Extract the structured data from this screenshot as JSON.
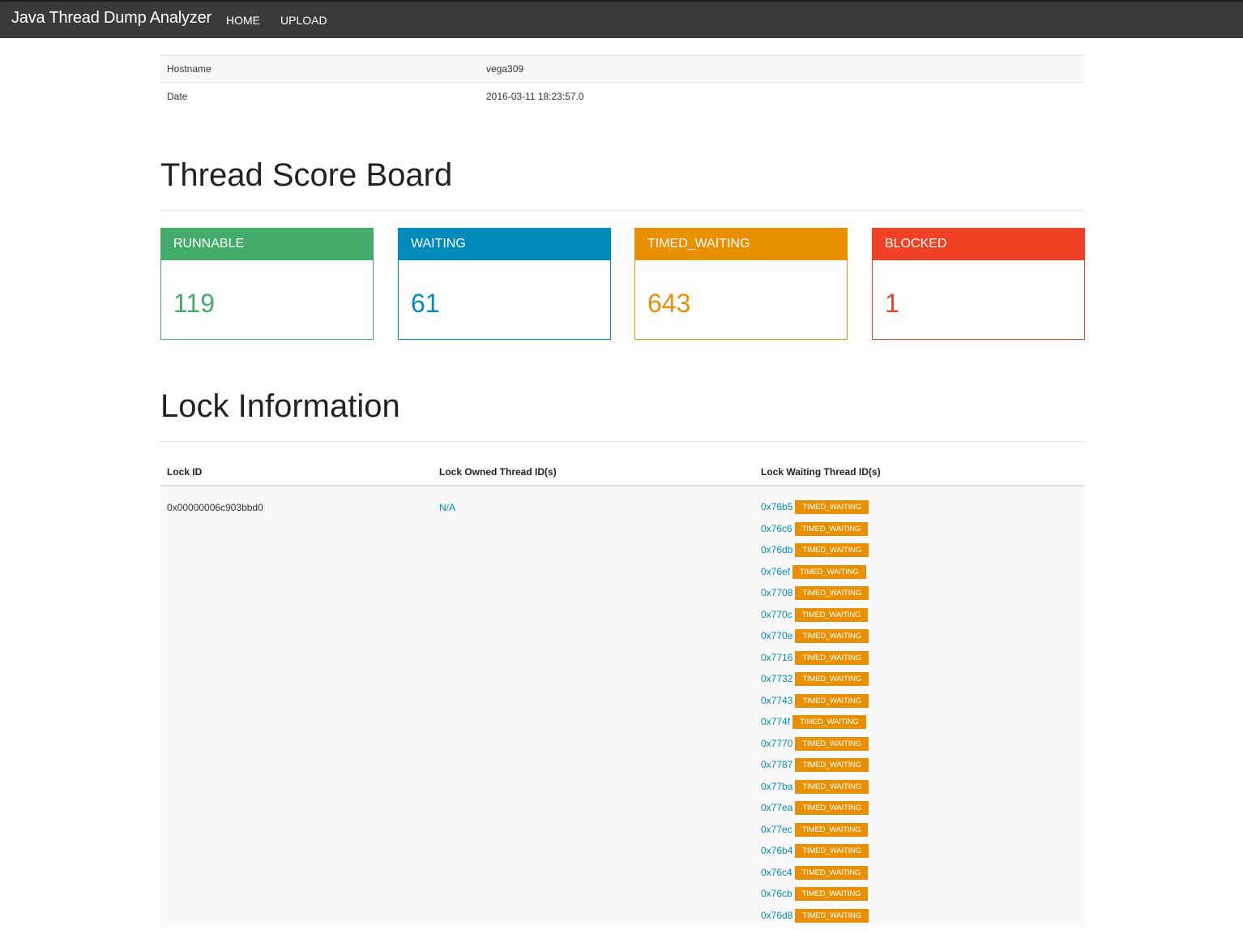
{
  "navbar": {
    "brand": "Java Thread Dump Analyzer",
    "links": [
      "HOME",
      "UPLOAD"
    ]
  },
  "info": [
    {
      "key": "Hostname",
      "value": "vega309"
    },
    {
      "key": "Date",
      "value": "2016-03-11 18:23:57.0"
    }
  ],
  "scoreboard": {
    "title": "Thread Score Board",
    "panels": [
      {
        "state": "RUNNABLE",
        "count": "119",
        "color": "#43ac6a"
      },
      {
        "state": "WAITING",
        "count": "61",
        "color": "#008cba"
      },
      {
        "state": "TIMED_WAITING",
        "count": "643",
        "color": "#e99002"
      },
      {
        "state": "BLOCKED",
        "count": "1",
        "color": "#f04124"
      }
    ]
  },
  "locks": {
    "title": "Lock Information",
    "columns": [
      "Lock ID",
      "Lock Owned Thread ID(s)",
      "Lock Waiting Thread ID(s)"
    ],
    "rows": [
      {
        "lock_id": "0x00000006c903bbd0",
        "owner": "N/A",
        "waiting": [
          {
            "id": "0x76b5",
            "state": "TIMED_WAITING"
          },
          {
            "id": "0x76c6",
            "state": "TIMED_WAITING"
          },
          {
            "id": "0x76db",
            "state": "TIMED_WAITING"
          },
          {
            "id": "0x76ef",
            "state": "TIMED_WAITING"
          },
          {
            "id": "0x7708",
            "state": "TIMED_WAITING"
          },
          {
            "id": "0x770c",
            "state": "TIMED_WAITING"
          },
          {
            "id": "0x770e",
            "state": "TIMED_WAITING"
          },
          {
            "id": "0x7716",
            "state": "TIMED_WAITING"
          },
          {
            "id": "0x7732",
            "state": "TIMED_WAITING"
          },
          {
            "id": "0x7743",
            "state": "TIMED_WAITING"
          },
          {
            "id": "0x774f",
            "state": "TIMED_WAITING"
          },
          {
            "id": "0x7770",
            "state": "TIMED_WAITING"
          },
          {
            "id": "0x7787",
            "state": "TIMED_WAITING"
          },
          {
            "id": "0x77ba",
            "state": "TIMED_WAITING"
          },
          {
            "id": "0x77ea",
            "state": "TIMED_WAITING"
          },
          {
            "id": "0x77ec",
            "state": "TIMED_WAITING"
          },
          {
            "id": "0x76b4",
            "state": "TIMED_WAITING"
          },
          {
            "id": "0x76c4",
            "state": "TIMED_WAITING"
          },
          {
            "id": "0x76cb",
            "state": "TIMED_WAITING"
          },
          {
            "id": "0x76d8",
            "state": "TIMED_WAITING"
          }
        ]
      }
    ]
  }
}
